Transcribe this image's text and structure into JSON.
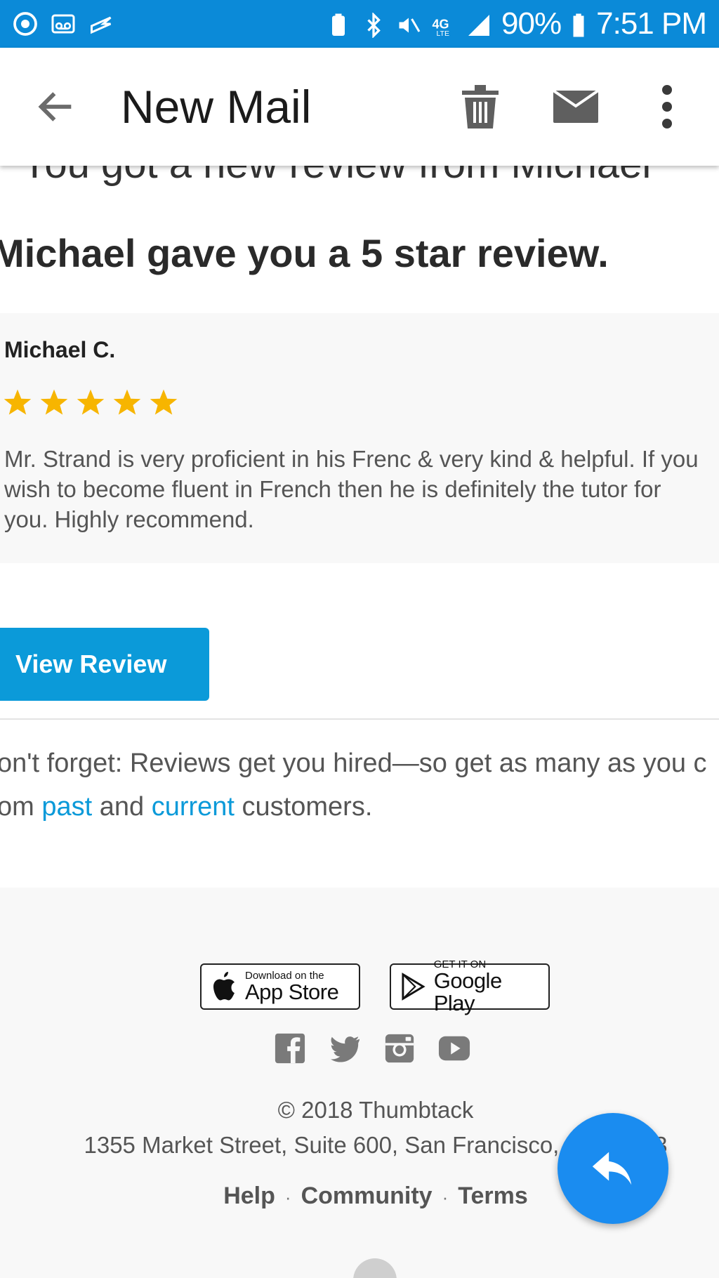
{
  "status_bar": {
    "battery_percent": "90%",
    "time": "7:51 PM",
    "network": "4G LTE",
    "icons": [
      "chrome-icon",
      "voicemail-mail-icon",
      "zillow-icon",
      "battery-saver-icon",
      "bluetooth-icon",
      "mute-icon",
      "network-4g-icon",
      "signal-icon",
      "battery-icon"
    ]
  },
  "app_bar": {
    "title": "New Mail",
    "icons": [
      "back-arrow-icon",
      "trash-icon",
      "mail-icon",
      "more-vert-icon"
    ]
  },
  "email": {
    "partial_title": "You got a new review from Michael",
    "headline": "Michael gave you a 5 star review.",
    "review": {
      "reviewer": "Michael C.",
      "rating": 5,
      "text": "Mr. Strand is very proficient in his Frenc & very kind & helpful. If you\nwish to become fluent in French then he is definitely the tutor for\nyou. Highly recommend."
    },
    "button_label": "View Review",
    "tip": {
      "line1": "on't forget: Reviews get you hired—so get as many as you c",
      "prefix": "om ",
      "link_past": "past",
      "middle": " and ",
      "link_current": "current",
      "suffix": " customers."
    }
  },
  "footer": {
    "app_store": {
      "small": "Download on the",
      "big": "App Store"
    },
    "google_play": {
      "small": "GET IT ON",
      "big": "Google Play"
    },
    "social_icons": [
      "facebook-icon",
      "twitter-icon",
      "instagram-icon",
      "youtube-icon"
    ],
    "copyright": "© 2018 Thumbtack",
    "address": "1355 Market Street, Suite 600, San Francisco, CA 94103",
    "links": [
      "Help",
      "Community",
      "Terms"
    ],
    "separator": "·"
  },
  "fab": {
    "icon": "reply-icon"
  },
  "colors": {
    "status_bar": "#0b8ad8",
    "button": "#0b9ad9",
    "link": "#0b9ad9",
    "star": "#f7b500",
    "fab": "#1a8cf0"
  }
}
